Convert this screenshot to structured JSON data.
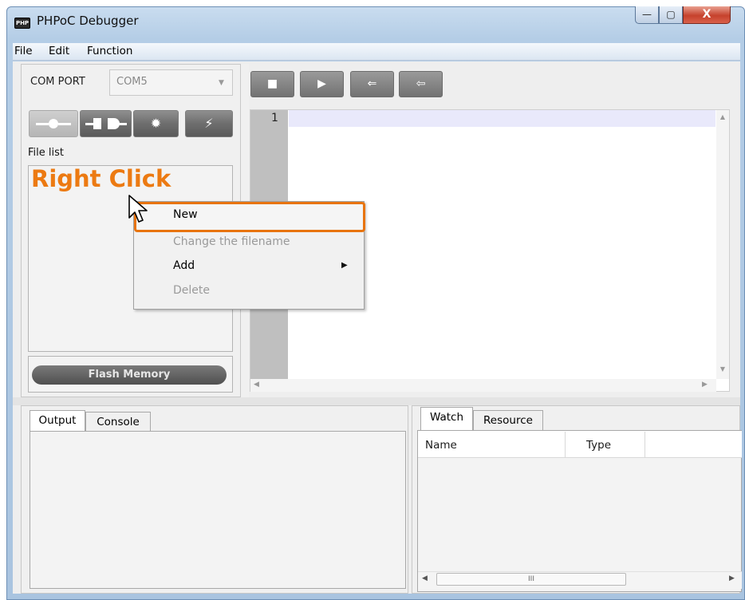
{
  "window": {
    "title": "PHPoC Debugger",
    "icon_text": "PHP",
    "minimize_glyph": "—",
    "maximize_glyph": "▢",
    "close_glyph": "X"
  },
  "menubar": {
    "items": [
      "File",
      "Edit",
      "Function"
    ]
  },
  "left_panel": {
    "com_port_label": "COM PORT",
    "com_port_value": "COM5",
    "file_list_label": "File list",
    "flash_memory_label": "Flash Memory"
  },
  "editor": {
    "line_numbers": [
      "1"
    ]
  },
  "annotation": {
    "text": "Right Click",
    "color": "#ec7a12"
  },
  "context_menu": {
    "items": [
      {
        "label": "New",
        "enabled": true,
        "highlighted": true
      },
      {
        "label": "Change the filename",
        "enabled": false
      },
      {
        "label": "Add",
        "enabled": true,
        "submenu": true
      },
      {
        "label": "Delete",
        "enabled": false
      }
    ],
    "highlight_color": "#e8740f"
  },
  "output_panel": {
    "tabs": [
      "Output",
      "Console"
    ],
    "active_tab": "Output"
  },
  "watch_panel": {
    "tabs": [
      "Watch",
      "Resource"
    ],
    "active_tab": "Watch",
    "columns": [
      "Name",
      "Type"
    ],
    "scroll_thumb_glyph": "III"
  }
}
